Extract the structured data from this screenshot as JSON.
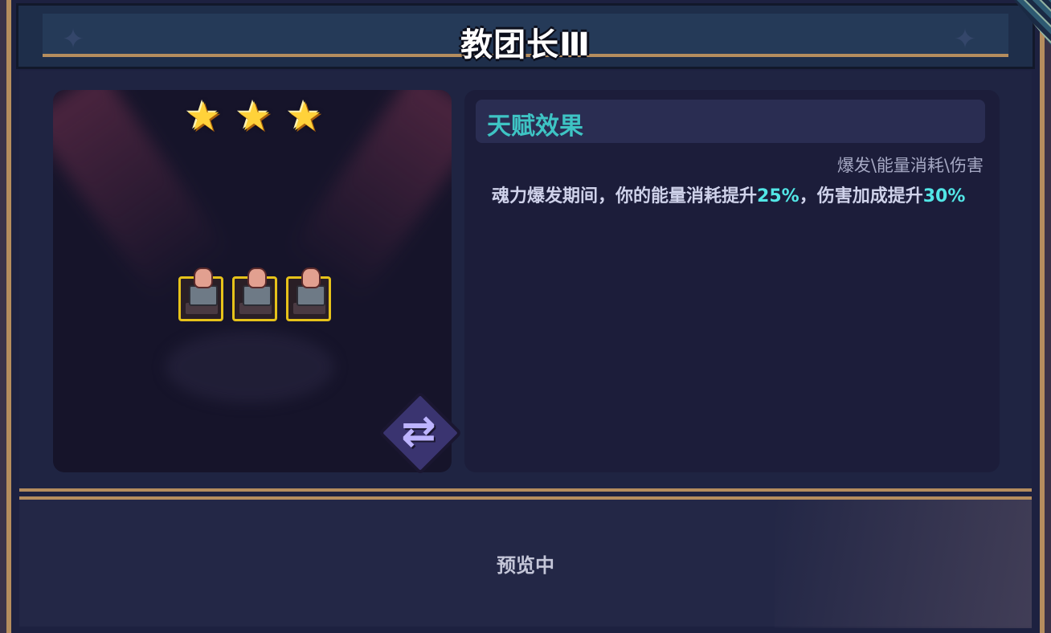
{
  "header": {
    "title": "教团长Ⅲ"
  },
  "stage": {
    "stars": [
      "★",
      "★",
      "★"
    ],
    "units": [
      "unit",
      "unit",
      "unit"
    ],
    "swap_icon": "⇄"
  },
  "talent": {
    "title": "天赋效果",
    "tags": "爆发\\能量消耗\\伤害",
    "desc_part1": "魂力爆发期间，你的能量消耗提升",
    "desc_value1": "25%",
    "desc_part2": "，伤害加成提升",
    "desc_value2": "30%"
  },
  "footer": {
    "status": "预览中"
  },
  "colors": {
    "highlight": "#52e6e6",
    "accent_title": "#3ec4c4",
    "frame_border": "#b58d5e",
    "star": "#ffd23a",
    "unit_border": "#e6c21a"
  }
}
